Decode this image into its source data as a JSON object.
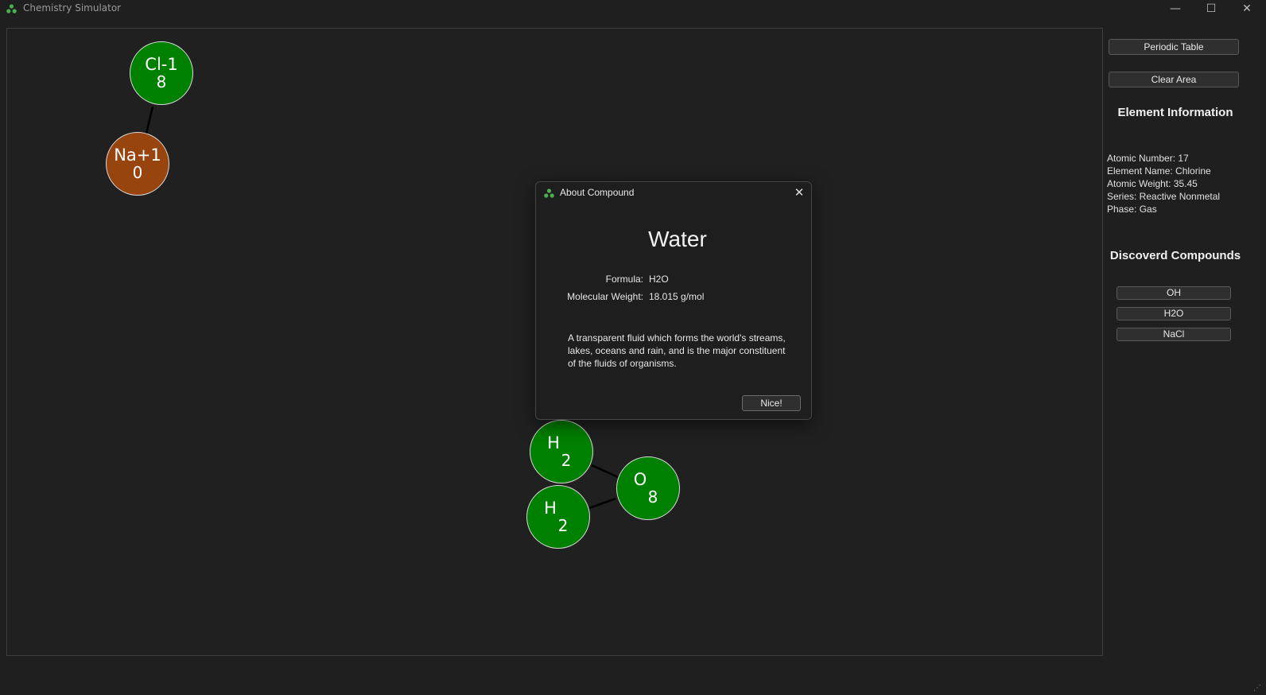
{
  "app": {
    "title": "Chemistry Simulator"
  },
  "window_controls": {
    "minimize": "—",
    "maximize": "☐",
    "close": "✕"
  },
  "atoms": [
    {
      "symbol": "Cl-1",
      "number": "8",
      "color": "#008000"
    },
    {
      "symbol": "Na+1",
      "number": "0",
      "color": "#98440f"
    },
    {
      "symbol": "H",
      "number": "2",
      "color": "#008000"
    },
    {
      "symbol": "O",
      "number": "8",
      "color": "#008000"
    },
    {
      "symbol": "H",
      "number": "2",
      "color": "#008000"
    }
  ],
  "sidebar": {
    "periodic_table_button": "Periodic Table",
    "clear_area_button": "Clear Area",
    "element_info_heading": "Element Information",
    "element_info": {
      "atomic_number": "Atomic Number: 17",
      "element_name": "Element Name: Chlorine",
      "atomic_weight": "Atomic Weight: 35.45",
      "series": "Series: Reactive Nonmetal",
      "phase": "Phase: Gas"
    },
    "compounds_heading": "Discoverd Compounds",
    "compounds": [
      "OH",
      "H2O",
      "NaCl"
    ]
  },
  "dialog": {
    "title": "About Compound",
    "close": "✕",
    "name": "Water",
    "formula_label": "Formula:",
    "formula_value": "H2O",
    "weight_label": "Molecular Weight:",
    "weight_value": "18.015 g/mol",
    "description": "A transparent fluid which forms the world's streams, lakes, oceans and rain, and is the major constituent of the fluids of organisms.",
    "ok_button": "Nice!"
  },
  "colors": {
    "accent_green": "#008000",
    "sodium_orange": "#98440f",
    "background": "#1f1f1f"
  }
}
